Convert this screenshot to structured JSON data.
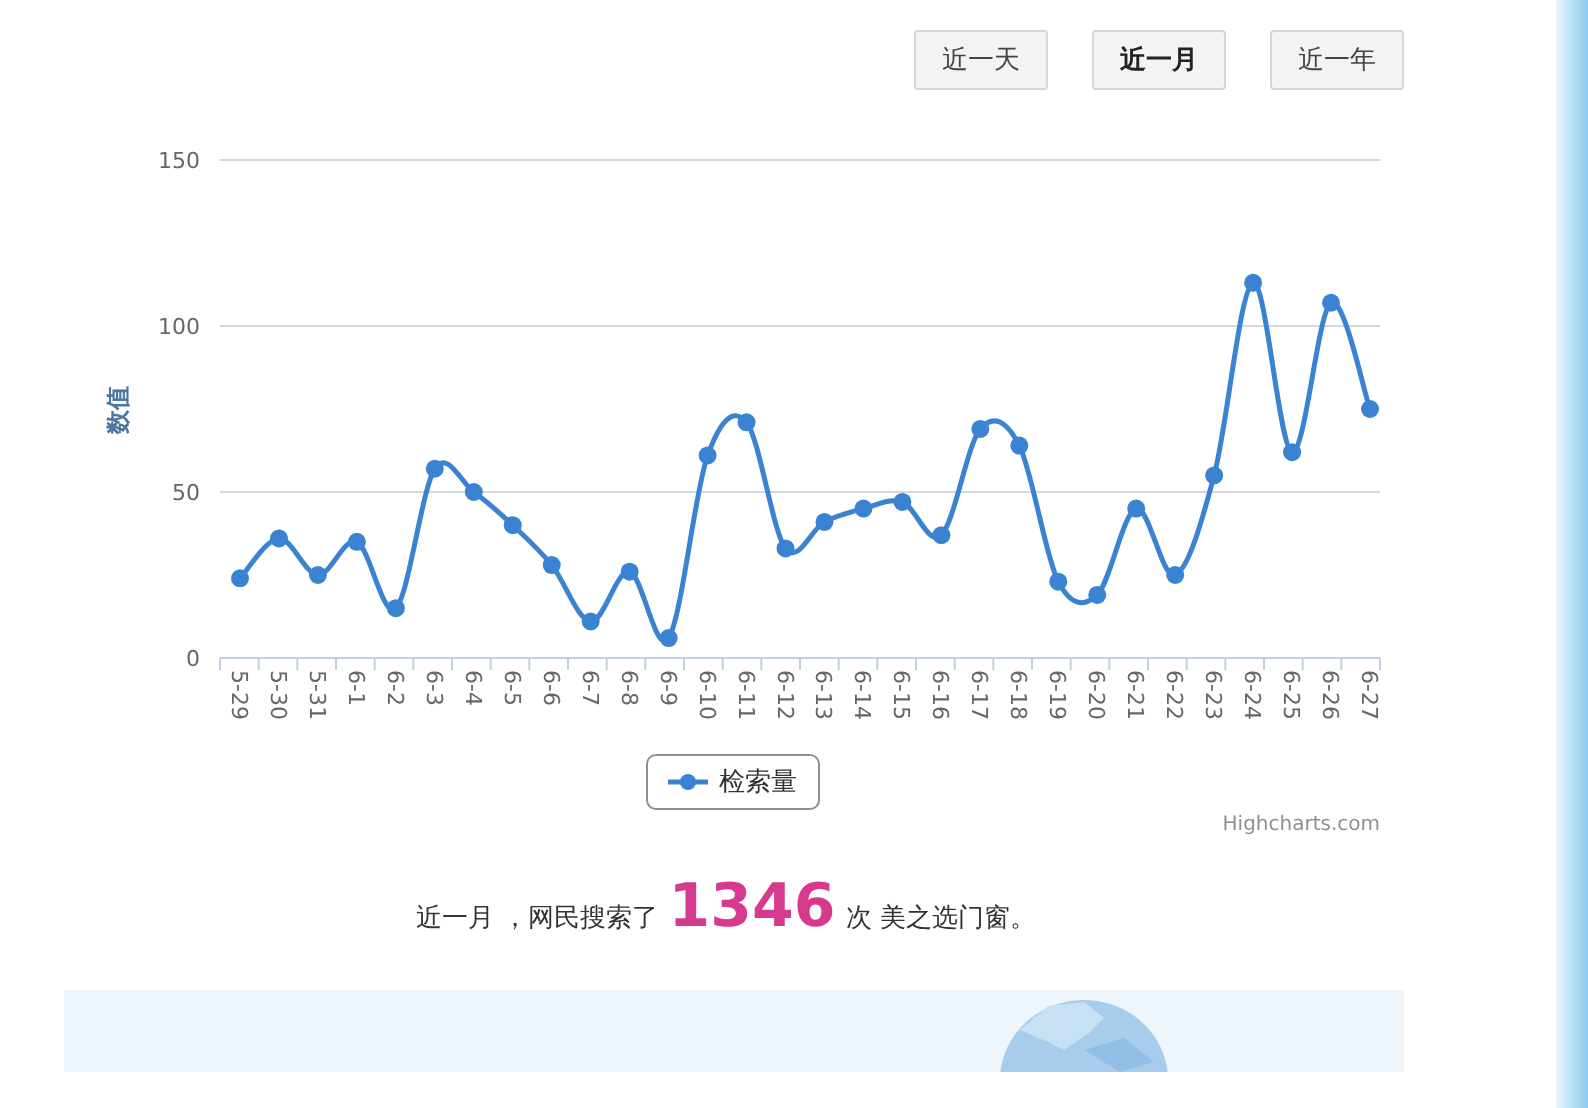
{
  "ranges": [
    {
      "label": "近一天",
      "selected": false
    },
    {
      "label": "近一月",
      "selected": true
    },
    {
      "label": "近一年",
      "selected": false
    }
  ],
  "chart": {
    "chart_data": {
      "type": "line",
      "ylabel": "数值",
      "categories": [
        "5-29",
        "5-30",
        "5-31",
        "6-1",
        "6-2",
        "6-3",
        "6-4",
        "6-5",
        "6-6",
        "6-7",
        "6-8",
        "6-9",
        "6-10",
        "6-11",
        "6-12",
        "6-13",
        "6-14",
        "6-15",
        "6-16",
        "6-17",
        "6-18",
        "6-19",
        "6-20",
        "6-21",
        "6-22",
        "6-23",
        "6-24",
        "6-25",
        "6-26",
        "6-27"
      ],
      "ylim": [
        0,
        150
      ],
      "yticks": [
        0,
        50,
        100,
        150
      ],
      "series": [
        {
          "name": "检索量",
          "color": "#3a83d2",
          "marker": true,
          "values": [
            24,
            36,
            25,
            35,
            15,
            57,
            50,
            40,
            28,
            11,
            26,
            6,
            61,
            71,
            33,
            41,
            45,
            47,
            37,
            69,
            64,
            23,
            19,
            45,
            25,
            55,
            113,
            62,
            107,
            75
          ]
        }
      ]
    },
    "credit": "Highcharts.com"
  },
  "summary": {
    "prefix": "近一月 ，网民搜索了",
    "count": "1346",
    "suffix": "次 美之选门窗。"
  }
}
